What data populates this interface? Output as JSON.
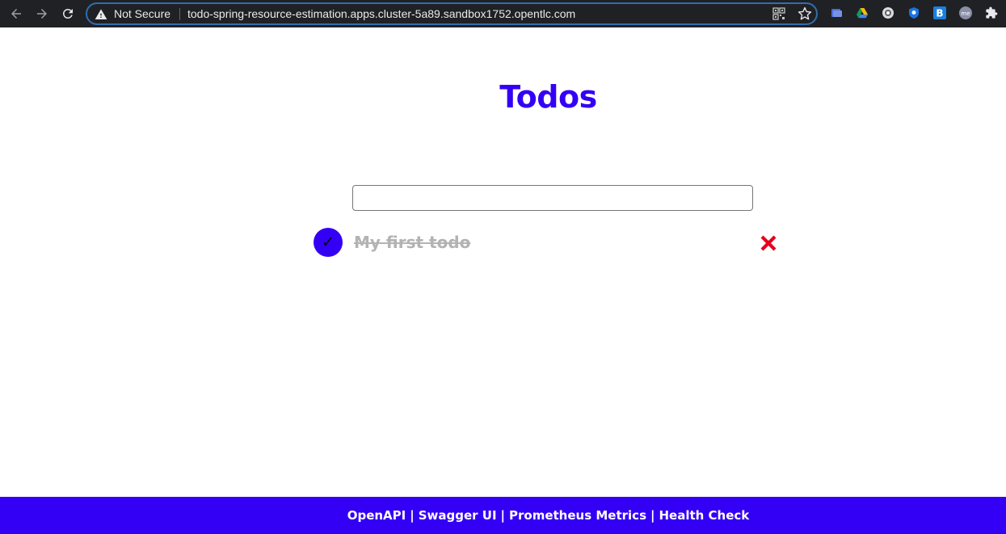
{
  "browser": {
    "security_label": "Not Secure",
    "url": "todo-spring-resource-estimation.apps.cluster-5a89.sandbox1752.opentlc.com",
    "nav_icons": [
      "back-arrow-icon",
      "forward-arrow-icon",
      "reload-icon"
    ],
    "extension_icons": [
      "page-extension-icon",
      "google-drive-icon",
      "circle-extension-icon",
      "shield-extension-icon",
      "b-extension-icon",
      "profile-avatar-icon",
      "puzzle-extensions-icon"
    ],
    "profile_initials": "me",
    "b_extension_letter": "B"
  },
  "app": {
    "title": "Todos",
    "new_todo": {
      "value": "",
      "placeholder": ""
    },
    "todos": [
      {
        "title": "My first todo",
        "completed": true,
        "toggle_glyph": "✓"
      }
    ]
  },
  "footer": {
    "links": [
      "OpenAPI",
      "Swagger UI",
      "Prometheus Metrics",
      "Health Check"
    ],
    "separator": "|"
  },
  "colors": {
    "accent": "#3400f5",
    "completed_text": "#b3b3b3",
    "delete": "#e8001c",
    "chrome_bg": "#202124"
  }
}
